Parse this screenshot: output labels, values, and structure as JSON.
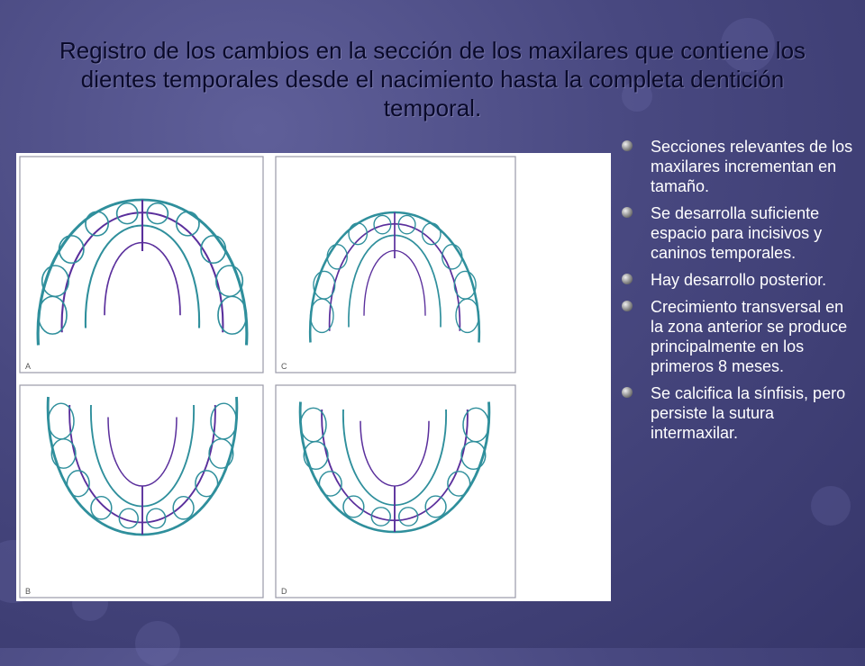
{
  "slide": {
    "title": "Registro de los cambios en la sección de los maxilares que contiene los dientes temporales desde el nacimiento hasta la completa dentición temporal."
  },
  "figure": {
    "panel_labels": [
      "A",
      "C",
      "B",
      "D"
    ]
  },
  "bullets": [
    "Secciones relevantes de los maxilares incrementan en tamaño.",
    "Se desarrolla suficiente espacio para incisivos y caninos temporales.",
    "Hay desarrollo posterior.",
    "Crecimiento transversal en la zona anterior se produce principalmente en los primeros 8 meses.",
    "Se calcifica la sínfisis, pero persiste la sutura intermaxilar."
  ],
  "colors": {
    "background": "#484880",
    "title_text": "#0a0a2a",
    "bullet_text": "#ffffff",
    "outline_teal": "#2f8f9c",
    "outline_purple": "#5a2f9c"
  }
}
